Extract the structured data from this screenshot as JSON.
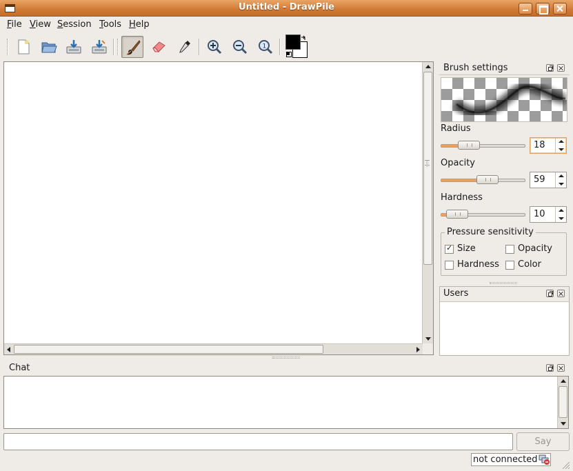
{
  "window": {
    "title": "Untitled - DrawPile"
  },
  "menu": [
    "File",
    "View",
    "Session",
    "Tools",
    "Help"
  ],
  "toolbar": {
    "buttons": [
      "new-icon",
      "open-icon",
      "save-icon",
      "save-as-icon",
      "brush-icon",
      "eraser-icon",
      "color-picker-icon",
      "zoom-in-icon",
      "zoom-out-icon",
      "zoom-reset-icon"
    ],
    "active_tool": "brush-icon",
    "foreground_color": "#000000",
    "background_color": "#ffffff"
  },
  "brush_settings": {
    "title": "Brush settings",
    "radius": {
      "label": "Radius",
      "value": "18",
      "slider_fraction": 0.33
    },
    "opacity": {
      "label": "Opacity",
      "value": "59",
      "slider_fraction": 0.59
    },
    "hardness": {
      "label": "Hardness",
      "value": "10",
      "slider_fraction": 0.1
    },
    "pressure": {
      "title": "Pressure sensitivity",
      "size": {
        "label": "Size",
        "checked": true
      },
      "opacity": {
        "label": "Opacity",
        "checked": false
      },
      "hardness": {
        "label": "Hardness",
        "checked": false
      },
      "color": {
        "label": "Color",
        "checked": false
      }
    }
  },
  "users": {
    "title": "Users"
  },
  "chat": {
    "title": "Chat",
    "input_value": "",
    "say_label": "Say"
  },
  "status": {
    "connection": "not connected"
  },
  "colors": {
    "accent": "#e9a15d",
    "titlebar": "#d07a36"
  }
}
